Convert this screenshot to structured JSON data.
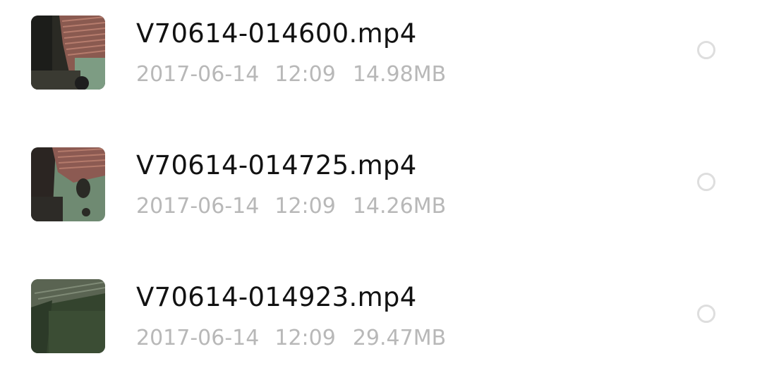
{
  "files": [
    {
      "name": "V70614-014600.mp4",
      "date": "2017-06-14",
      "time": "12:09",
      "size": "14.98MB",
      "thumbnail": "video-thumbnail"
    },
    {
      "name": "V70614-014725.mp4",
      "date": "2017-06-14",
      "time": "12:09",
      "size": "14.26MB",
      "thumbnail": "video-thumbnail"
    },
    {
      "name": "V70614-014923.mp4",
      "date": "2017-06-14",
      "time": "12:09",
      "size": "29.47MB",
      "thumbnail": "video-thumbnail"
    }
  ],
  "colors": {
    "name_text": "#121212",
    "meta_text": "#b8b8b8",
    "radio_border": "#dedede",
    "background": "#ffffff"
  }
}
